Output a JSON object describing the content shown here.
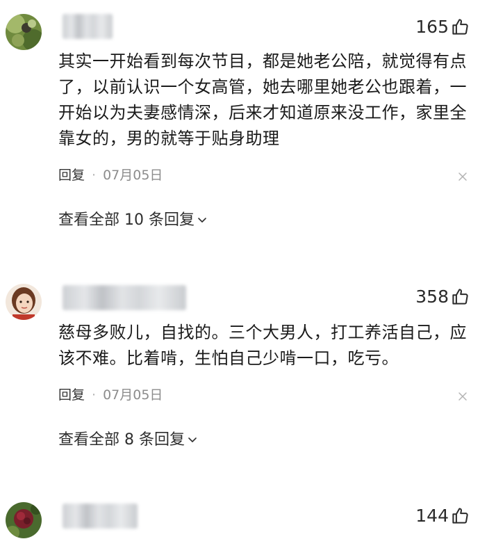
{
  "comments": [
    {
      "likes": "165",
      "text": "其实一开始看到每次节目，都是她老公陪，就觉得有点了，以前认识一个女高管，她去哪里她老公也跟着，一开始以为夫妻感情深，后来才知道原来没工作，家里全靠女的，男的就等于贴身助理",
      "reply_label": "回复",
      "separator": "·",
      "date": "07月05日",
      "view_replies": "查看全部 10 条回复"
    },
    {
      "likes": "358",
      "text": "慈母多败儿，自找的。三个大男人，打工养活自己，应该不难。比着啃，生怕自己少啃一口，吃亏。",
      "reply_label": "回复",
      "separator": "·",
      "date": "07月05日",
      "view_replies": "查看全部 8 条回复"
    },
    {
      "likes": "144"
    }
  ],
  "icons": {
    "like": "thumbs-up-icon",
    "close": "close-icon",
    "expand": "chevron-down-icon"
  },
  "colors": {
    "text": "#1a1a1a",
    "meta": "#8c8c8c",
    "background": "#ffffff"
  }
}
